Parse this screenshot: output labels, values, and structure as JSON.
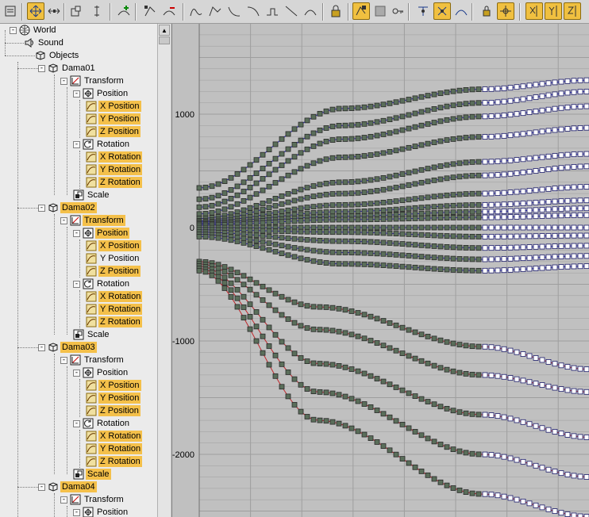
{
  "toolbar": {
    "buttons": [
      {
        "name": "filters-button",
        "icon": "filters-icon",
        "active": false
      },
      {
        "name": "move-keys-button",
        "icon": "move-keys-icon",
        "active": true
      },
      {
        "name": "slide-keys-button",
        "icon": "slide-keys-icon",
        "active": false
      },
      {
        "name": "scale-keys-button",
        "icon": "scale-keys-icon",
        "active": false
      },
      {
        "name": "scale-values-button",
        "icon": "scale-values-icon",
        "active": false
      },
      {
        "name": "add-keys-button",
        "icon": "add-keys-icon",
        "active": false
      },
      {
        "name": "draw-curves-button",
        "icon": "draw-curves-icon",
        "active": false
      },
      {
        "name": "reduce-keys-button",
        "icon": "reduce-keys-icon",
        "active": false
      },
      {
        "name": "tangent-auto-button",
        "icon": "tangent-auto-icon",
        "active": false
      },
      {
        "name": "tangent-custom-button",
        "icon": "tangent-custom-icon",
        "active": false
      },
      {
        "name": "tangent-fast-button",
        "icon": "tangent-fast-icon",
        "active": false
      },
      {
        "name": "tangent-slow-button",
        "icon": "tangent-slow-icon",
        "active": false
      },
      {
        "name": "tangent-step-button",
        "icon": "tangent-step-icon",
        "active": false
      },
      {
        "name": "tangent-linear-button",
        "icon": "tangent-linear-icon",
        "active": false
      },
      {
        "name": "tangent-smooth-button",
        "icon": "tangent-smooth-icon",
        "active": false
      },
      {
        "name": "lock-selection-button",
        "icon": "lock-selection-icon",
        "active": false
      },
      {
        "name": "snap-frames-button",
        "icon": "snap-frames-icon",
        "active": true
      },
      {
        "name": "parameter-curve-oor-button",
        "icon": "out-of-range-icon",
        "active": false
      },
      {
        "name": "show-keyable-button",
        "icon": "keyable-icon",
        "active": false
      },
      {
        "name": "show-all-tangents-button",
        "icon": "all-tangents-icon",
        "active": false
      },
      {
        "name": "show-tangents-button",
        "icon": "show-tangents-icon",
        "active": true
      },
      {
        "name": "show-curves-button",
        "icon": "show-curves-icon",
        "active": false
      },
      {
        "name": "lock-tangents-button",
        "icon": "lock-tangents-icon",
        "active": false
      },
      {
        "name": "position-ranges-button",
        "icon": "position-ranges-icon",
        "active": true
      },
      {
        "name": "x-axis-button",
        "icon": "x-axis-icon",
        "active": true
      },
      {
        "name": "y-axis-button",
        "icon": "y-axis-icon",
        "active": true
      },
      {
        "name": "z-axis-button",
        "icon": "z-axis-icon",
        "active": true
      }
    ]
  },
  "tree": {
    "rows": [
      {
        "label": "World",
        "icon": "globe-icon",
        "depth": 0,
        "expander": "-",
        "highlight": false
      },
      {
        "label": "Sound",
        "icon": "sound-icon",
        "depth": 1,
        "expander": "",
        "highlight": false
      },
      {
        "label": "Objects",
        "icon": "object-cube-icon",
        "depth": 2,
        "expander": "",
        "highlight": false
      },
      {
        "label": "Dama01",
        "icon": "object-cube-icon",
        "depth": 3,
        "expander": "-",
        "highlight": false
      },
      {
        "label": "Transform",
        "icon": "transform-icon",
        "depth": 4,
        "expander": "-",
        "highlight": false
      },
      {
        "label": "Position",
        "icon": "position-icon",
        "depth": 5,
        "expander": "-",
        "highlight": false
      },
      {
        "label": "X Position",
        "icon": "curve-icon",
        "depth": 6,
        "expander": "",
        "highlight": true
      },
      {
        "label": "Y Position",
        "icon": "curve-icon",
        "depth": 6,
        "expander": "",
        "highlight": true
      },
      {
        "label": "Z Position",
        "icon": "curve-icon",
        "depth": 6,
        "expander": "",
        "highlight": true
      },
      {
        "label": "Rotation",
        "icon": "rotation-icon",
        "depth": 5,
        "expander": "-",
        "highlight": false
      },
      {
        "label": "X Rotation",
        "icon": "curve-icon",
        "depth": 6,
        "expander": "",
        "highlight": true
      },
      {
        "label": "Y Rotation",
        "icon": "curve-icon",
        "depth": 6,
        "expander": "",
        "highlight": true
      },
      {
        "label": "Z Rotation",
        "icon": "curve-icon",
        "depth": 6,
        "expander": "",
        "highlight": true
      },
      {
        "label": "Scale",
        "icon": "scale-icon",
        "depth": 5,
        "expander": "",
        "highlight": false
      },
      {
        "label": "Dama02",
        "icon": "object-cube-icon",
        "depth": 3,
        "expander": "-",
        "highlight": true
      },
      {
        "label": "Transform",
        "icon": "transform-icon",
        "depth": 4,
        "expander": "-",
        "highlight": true
      },
      {
        "label": "Position",
        "icon": "position-icon",
        "depth": 5,
        "expander": "-",
        "highlight": true
      },
      {
        "label": "X Position",
        "icon": "curve-icon",
        "depth": 6,
        "expander": "",
        "highlight": true
      },
      {
        "label": "Y Position",
        "icon": "curve-icon",
        "depth": 6,
        "expander": "",
        "highlight": false
      },
      {
        "label": "Z Position",
        "icon": "curve-icon",
        "depth": 6,
        "expander": "",
        "highlight": true
      },
      {
        "label": "Rotation",
        "icon": "rotation-icon",
        "depth": 5,
        "expander": "-",
        "highlight": false
      },
      {
        "label": "X Rotation",
        "icon": "curve-icon",
        "depth": 6,
        "expander": "",
        "highlight": true
      },
      {
        "label": "Y Rotation",
        "icon": "curve-icon",
        "depth": 6,
        "expander": "",
        "highlight": true
      },
      {
        "label": "Z Rotation",
        "icon": "curve-icon",
        "depth": 6,
        "expander": "",
        "highlight": true
      },
      {
        "label": "Scale",
        "icon": "scale-icon",
        "depth": 5,
        "expander": "",
        "highlight": false
      },
      {
        "label": "Dama03",
        "icon": "object-cube-icon",
        "depth": 3,
        "expander": "-",
        "highlight": true
      },
      {
        "label": "Transform",
        "icon": "transform-icon",
        "depth": 4,
        "expander": "-",
        "highlight": false
      },
      {
        "label": "Position",
        "icon": "position-icon",
        "depth": 5,
        "expander": "-",
        "highlight": false
      },
      {
        "label": "X Position",
        "icon": "curve-icon",
        "depth": 6,
        "expander": "",
        "highlight": true
      },
      {
        "label": "Y Position",
        "icon": "curve-icon",
        "depth": 6,
        "expander": "",
        "highlight": true
      },
      {
        "label": "Z Position",
        "icon": "curve-icon",
        "depth": 6,
        "expander": "",
        "highlight": true
      },
      {
        "label": "Rotation",
        "icon": "rotation-icon",
        "depth": 5,
        "expander": "-",
        "highlight": false
      },
      {
        "label": "X Rotation",
        "icon": "curve-icon",
        "depth": 6,
        "expander": "",
        "highlight": true
      },
      {
        "label": "Y Rotation",
        "icon": "curve-icon",
        "depth": 6,
        "expander": "",
        "highlight": true
      },
      {
        "label": "Z Rotation",
        "icon": "curve-icon",
        "depth": 6,
        "expander": "",
        "highlight": true
      },
      {
        "label": "Scale",
        "icon": "scale-icon",
        "depth": 5,
        "expander": "",
        "highlight": true
      },
      {
        "label": "Dama04",
        "icon": "object-cube-icon",
        "depth": 3,
        "expander": "-",
        "highlight": true
      },
      {
        "label": "Transform",
        "icon": "transform-icon",
        "depth": 4,
        "expander": "-",
        "highlight": false
      },
      {
        "label": "Position",
        "icon": "position-icon",
        "depth": 5,
        "expander": "-",
        "highlight": false
      }
    ]
  },
  "curve_editor": {
    "y_tick_labels": [
      "1000",
      "0",
      "-1000",
      "-2000"
    ],
    "y_ticks": [
      1000,
      0,
      -1000,
      -2000
    ],
    "colors": {
      "background": "#c0c0c0",
      "grid": "#9e9e9e",
      "key_selected": "#5a6e5a",
      "key_unselected": "#ffffff",
      "curve_red": "#c0282c",
      "curve_blue": "#2828c0",
      "curve_green": "#28a028"
    }
  }
}
